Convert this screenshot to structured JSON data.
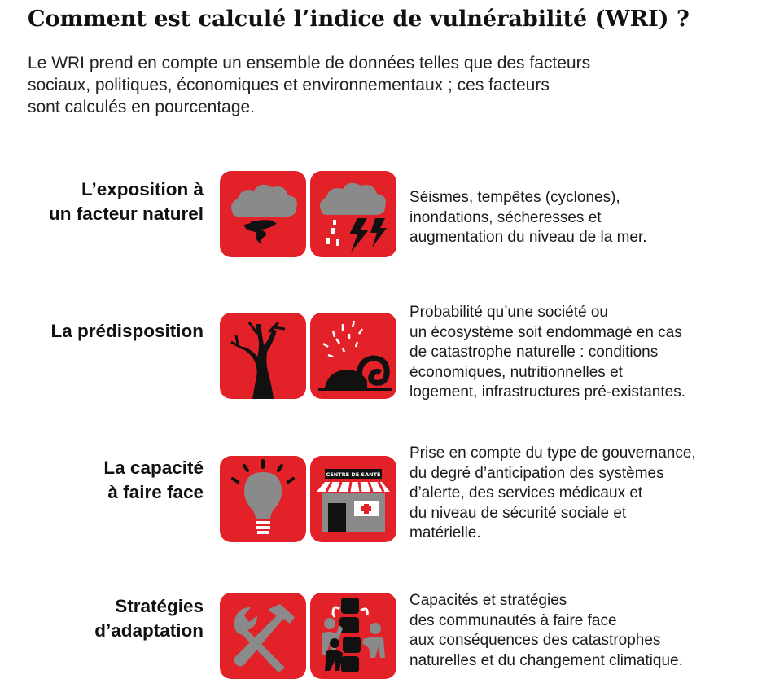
{
  "title": "Comment est calculé l’indice de vulnérabilité (WRI) ?",
  "intro": [
    "Le WRI prend en compte un ensemble de données telles que des facteurs",
    "sociaux, politiques, économiques et environnementaux ; ces facteurs",
    "sont calculés en pourcentage."
  ],
  "colors": {
    "accent": "#e22128",
    "icon_dark": "#111111",
    "icon_grey": "#8a8a8a"
  },
  "rows": [
    {
      "label": [
        "L’exposition à",
        "un facteur naturel"
      ],
      "icons": [
        "storm-tornado-icon",
        "storm-lightning-rain-icon"
      ],
      "description": [
        "Séismes, tempêtes (cyclones),",
        "inondations, sécheresses et",
        "augmentation du niveau de la mer."
      ]
    },
    {
      "label": [
        "La prédisposition"
      ],
      "icons": [
        "dead-tree-icon",
        "wave-flood-icon"
      ],
      "description": [
        "Probabilité qu’une société ou",
        "un écosystème soit endommagé en cas",
        "de catastrophe naturelle : conditions",
        "économiques, nutritionnelles et",
        "logement, infrastructures pré-existantes."
      ]
    },
    {
      "label": [
        "La capacité",
        "à faire face"
      ],
      "icons": [
        "light-bulb-icon",
        "health-center-icon"
      ],
      "health_center_sign": "CENTRE DE SANTÉ",
      "description": [
        "Prise en compte du type de gouvernance,",
        "du degré d’anticipation des systèmes",
        "d’alerte, des services médicaux et",
        "du niveau de sécurité sociale et",
        "matérielle."
      ]
    },
    {
      "label": [
        "Stratégies",
        "d’adaptation"
      ],
      "icons": [
        "tools-icon",
        "people-building-icon"
      ],
      "description": [
        "Capacités et stratégies",
        "des communautés à faire face",
        "aux conséquences des catastrophes",
        "naturelles et du changement climatique."
      ]
    }
  ]
}
